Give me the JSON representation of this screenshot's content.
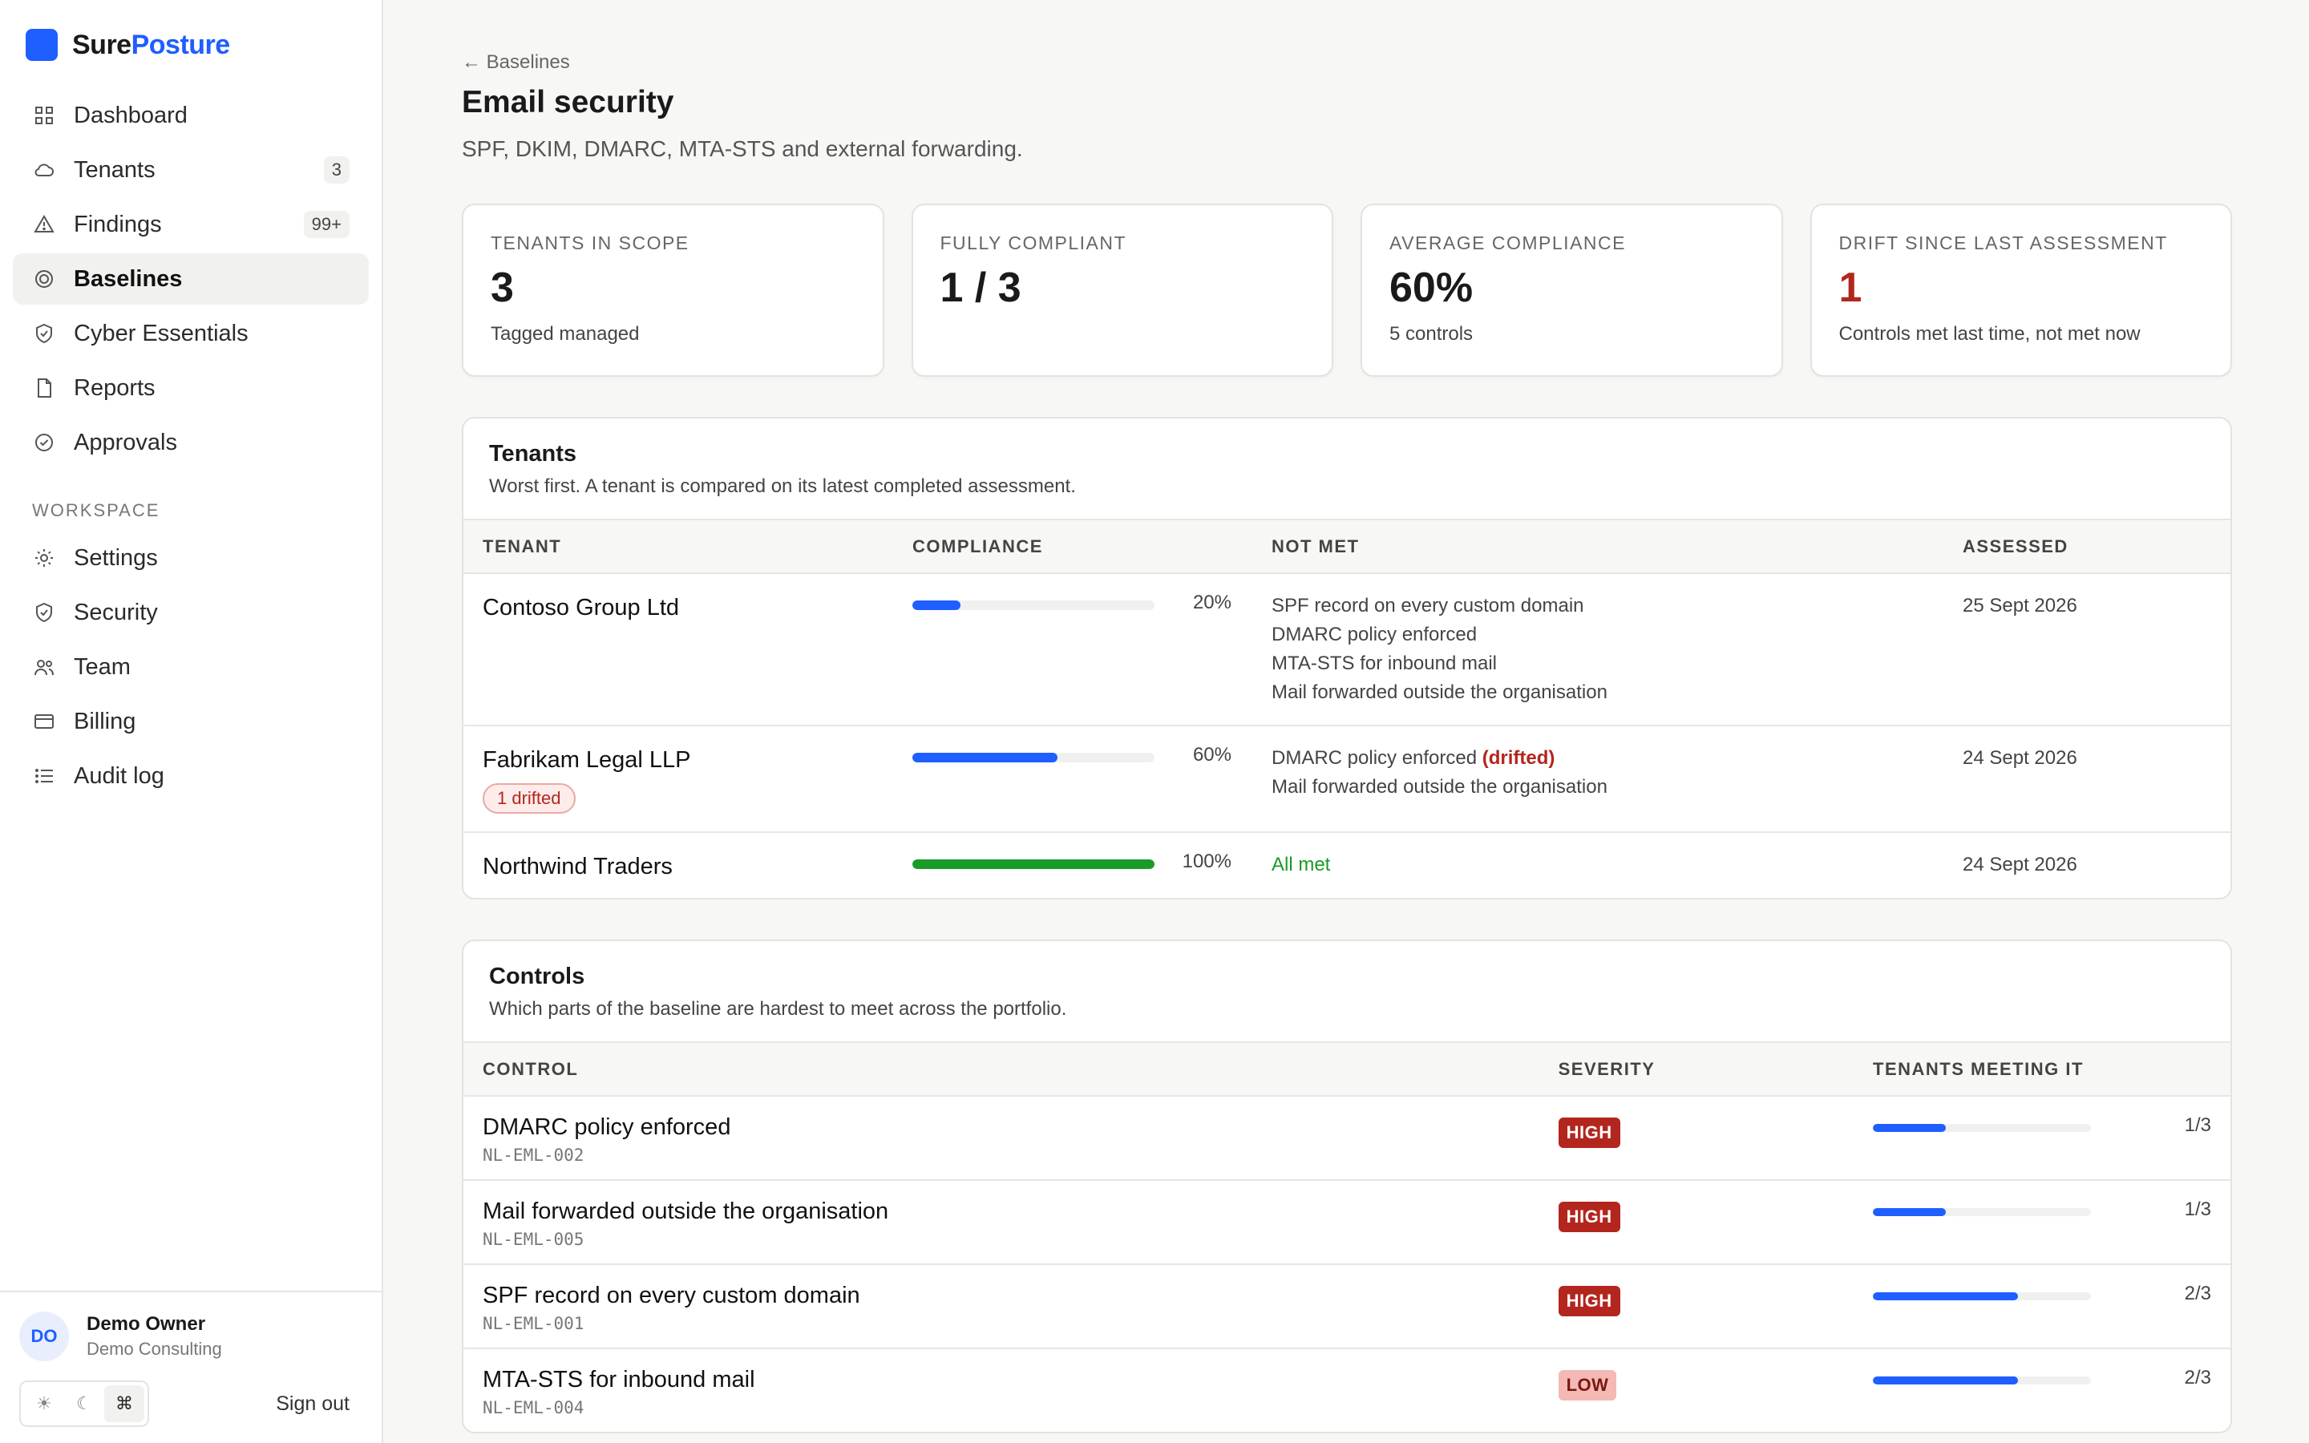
{
  "brand": {
    "name_part1": "Sure",
    "name_part2": "Posture"
  },
  "nav": [
    {
      "label": "Dashboard",
      "icon": "grid-icon",
      "badge": null,
      "active": false
    },
    {
      "label": "Tenants",
      "icon": "cloud-icon",
      "badge": "3",
      "active": false
    },
    {
      "label": "Findings",
      "icon": "warning-icon",
      "badge": "99+",
      "active": false
    },
    {
      "label": "Baselines",
      "icon": "target-icon",
      "badge": null,
      "active": true
    },
    {
      "label": "Cyber Essentials",
      "icon": "shield-check-icon",
      "badge": null,
      "active": false
    },
    {
      "label": "Reports",
      "icon": "document-icon",
      "badge": null,
      "active": false
    },
    {
      "label": "Approvals",
      "icon": "check-circle-icon",
      "badge": null,
      "active": false
    }
  ],
  "workspace": {
    "label": "WORKSPACE",
    "items": [
      {
        "label": "Settings",
        "icon": "gear-icon"
      },
      {
        "label": "Security",
        "icon": "shield-icon"
      },
      {
        "label": "Team",
        "icon": "users-icon"
      },
      {
        "label": "Billing",
        "icon": "card-icon"
      },
      {
        "label": "Audit log",
        "icon": "list-icon"
      }
    ]
  },
  "user": {
    "initials": "DO",
    "name": "Demo Owner",
    "org": "Demo Consulting",
    "sign_out": "Sign out"
  },
  "theme": {
    "light": "☀",
    "dark": "☾",
    "system": "⌘"
  },
  "page": {
    "back": "← Baselines",
    "title": "Email security",
    "subtitle": "SPF, DKIM, DMARC, MTA-STS and external forwarding."
  },
  "stats": [
    {
      "label": "Tenants in scope",
      "value": "3",
      "note": "Tagged managed",
      "red": false
    },
    {
      "label": "Fully compliant",
      "value": "1 / 3",
      "note": "",
      "red": false
    },
    {
      "label": "Average compliance",
      "value": "60%",
      "note": "5 controls",
      "red": false
    },
    {
      "label": "Drift since last assessment",
      "value": "1",
      "note": "Controls met last time, not met now",
      "red": true
    }
  ],
  "tenants": {
    "title": "Tenants",
    "subtitle": "Worst first. A tenant is compared on its latest completed assessment.",
    "headers": [
      "TENANT",
      "COMPLIANCE",
      "NOT MET",
      "ASSESSED"
    ],
    "rows": [
      {
        "name": "Contoso Group Ltd",
        "drift": "",
        "compliance": 20,
        "compliance_label": "20%",
        "not_met": [
          {
            "text": "SPF record on every custom domain",
            "drifted": ""
          },
          {
            "text": "DMARC policy enforced",
            "drifted": ""
          },
          {
            "text": "MTA-STS for inbound mail",
            "drifted": ""
          },
          {
            "text": "Mail forwarded outside the organisation",
            "drifted": ""
          }
        ],
        "all_met": "",
        "assessed": "25 Sept 2026",
        "green": false
      },
      {
        "name": "Fabrikam Legal LLP",
        "drift": "1 drifted",
        "compliance": 60,
        "compliance_label": "60%",
        "not_met": [
          {
            "text": "DMARC policy enforced",
            "drifted": "(drifted)"
          },
          {
            "text": "Mail forwarded outside the organisation",
            "drifted": ""
          }
        ],
        "all_met": "",
        "assessed": "24 Sept 2026",
        "green": false
      },
      {
        "name": "Northwind Traders",
        "drift": "",
        "compliance": 100,
        "compliance_label": "100%",
        "not_met": [],
        "all_met": "All met",
        "assessed": "24 Sept 2026",
        "green": true
      }
    ]
  },
  "controls": {
    "title": "Controls",
    "subtitle": "Which parts of the baseline are hardest to meet across the portfolio.",
    "headers": [
      "CONTROL",
      "SEVERITY",
      "TENANTS MEETING IT"
    ],
    "rows": [
      {
        "name": "DMARC policy enforced",
        "id": "NL-EML-002",
        "severity": "HIGH",
        "met": 1,
        "total": 3,
        "frac": "1/3"
      },
      {
        "name": "Mail forwarded outside the organisation",
        "id": "NL-EML-005",
        "severity": "HIGH",
        "met": 1,
        "total": 3,
        "frac": "1/3"
      },
      {
        "name": "SPF record on every custom domain",
        "id": "NL-EML-001",
        "severity": "HIGH",
        "met": 2,
        "total": 3,
        "frac": "2/3"
      },
      {
        "name": "MTA-STS for inbound mail",
        "id": "NL-EML-004",
        "severity": "LOW",
        "met": 2,
        "total": 3,
        "frac": "2/3"
      }
    ]
  }
}
